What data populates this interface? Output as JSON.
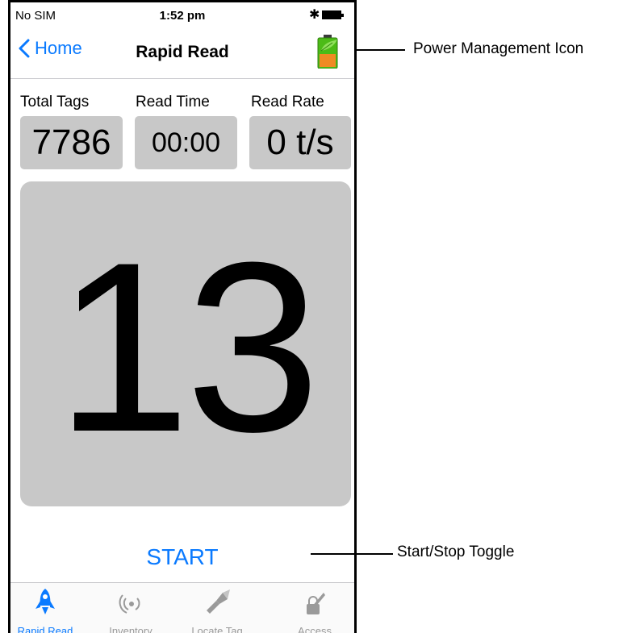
{
  "status_bar": {
    "carrier": "No SIM",
    "time": "1:52 pm"
  },
  "nav": {
    "back_label": "Home",
    "title": "Rapid Read"
  },
  "stats": {
    "total_tags_label": "Total Tags",
    "total_tags_value": "7786",
    "read_time_label": "Read Time",
    "read_time_value": "00:00",
    "read_rate_label": "Read Rate",
    "read_rate_value": "0 t/s"
  },
  "unique_count": "13",
  "start_label": "START",
  "tabs": [
    {
      "label": "Rapid Read",
      "icon": "rocket-icon",
      "active": true
    },
    {
      "label": "Inventory",
      "icon": "radio-waves-icon",
      "active": false
    },
    {
      "label": "Locate Tag",
      "icon": "flashlight-icon",
      "active": false
    },
    {
      "label": "Access",
      "icon": "lock-pen-icon",
      "active": false
    }
  ],
  "annotations": {
    "power_management": "Power Management Icon",
    "start_stop": "Start/Stop Toggle"
  },
  "colors": {
    "accent": "#0a7aff",
    "panel": "#c8c8c8",
    "battery_green": "#4cbb17",
    "battery_orange": "#f08a24"
  }
}
